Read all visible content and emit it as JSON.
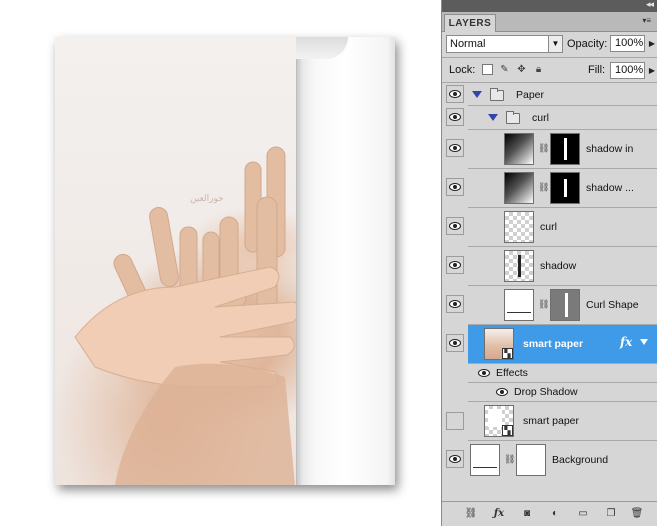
{
  "canvas": {
    "watermark_text": "خورالعين"
  },
  "panel": {
    "tab_label": "LAYERS",
    "blend_mode": "Normal",
    "opacity_label": "Opacity:",
    "opacity_value": "100%",
    "lock_label": "Lock:",
    "fill_label": "Fill:",
    "fill_value": "100%"
  },
  "layers": [
    {
      "name": "Paper",
      "kind": "group",
      "visible": true
    },
    {
      "name": "curl",
      "kind": "group",
      "visible": true
    },
    {
      "name": "shadow in",
      "kind": "masked",
      "visible": true
    },
    {
      "name": "shadow ...",
      "kind": "masked",
      "visible": true
    },
    {
      "name": "curl",
      "kind": "transparent",
      "visible": true
    },
    {
      "name": "shadow",
      "kind": "transparent",
      "visible": true
    },
    {
      "name": "Curl Shape",
      "kind": "masked",
      "visible": true
    },
    {
      "name": "smart paper",
      "kind": "smart",
      "visible": true,
      "selected": true,
      "fx": "fx"
    },
    {
      "name": "Effects",
      "kind": "effects-header",
      "visible": true
    },
    {
      "name": "Drop Shadow",
      "kind": "effect",
      "visible": true
    },
    {
      "name": "smart paper",
      "kind": "smart",
      "visible": false
    },
    {
      "name": "Background",
      "kind": "background",
      "visible": true
    }
  ],
  "colors": {
    "selected_row": "#3f9ae8",
    "panel_bg": "#d6d6d6"
  }
}
